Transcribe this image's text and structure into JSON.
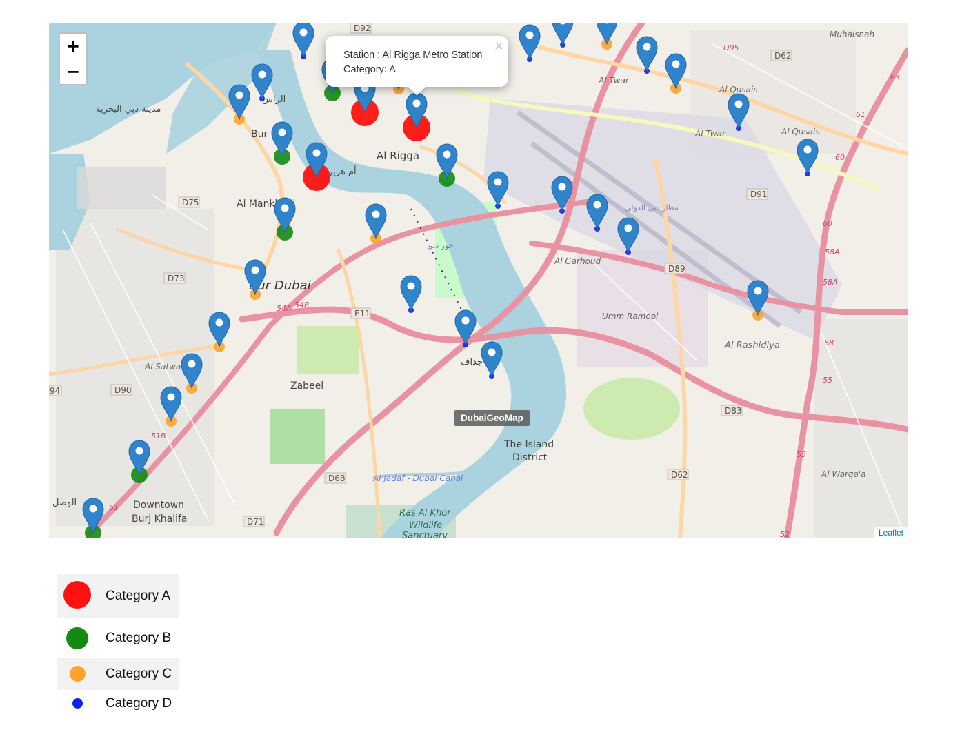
{
  "map": {
    "zoom_in_label": "+",
    "zoom_out_label": "−",
    "attribution": "Leaflet",
    "tooltip": "DubaiGeoMap",
    "popup": {
      "line1": "Station : Al Rigga Metro Station",
      "line2": "Category: A",
      "close_label": "×"
    },
    "place_labels": [
      "Al Rigga",
      "Bur Dubai",
      "Al Mankhool",
      "Zabeel",
      "Al Satwa",
      "Downtown",
      "Burj Khalifa",
      "The Island",
      "District",
      "Al Garhoud",
      "Umm Ramool",
      "Al Rashidiya",
      "Al Twar",
      "Al Qusais",
      "Muhaisnah",
      "Al Warqa'a",
      "Ras Al Khor",
      "Wildlife",
      "Sanctuary",
      "Al Jadaf - Dubai Canal"
    ],
    "arabic_labels": [
      "مدينة دبي البحرية",
      "الراس",
      "أم هرير",
      "جداف",
      "الوصل",
      "مطار دبي الدولي",
      "خور دبي"
    ],
    "road_labels": [
      "D92",
      "D62",
      "D95",
      "D75",
      "D73",
      "E11",
      "D90",
      "D91",
      "D89",
      "D83",
      "D62",
      "D68",
      "D71",
      "94",
      "63",
      "61",
      "60",
      "58",
      "55",
      "54",
      "51",
      "58A",
      "54B",
      "51B"
    ],
    "category_colors": {
      "A": "#ff1111",
      "B": "#138a13",
      "C": "#ffa22e",
      "D": "#0a23f0"
    },
    "marker_color": "#2f84cc"
  },
  "legend": [
    {
      "label": "Category A",
      "color": "#ff1111"
    },
    {
      "label": "Category B",
      "color": "#138a13"
    },
    {
      "label": "Category C",
      "color": "#ffa22e"
    },
    {
      "label": "Category D",
      "color": "#0a23f0"
    }
  ]
}
